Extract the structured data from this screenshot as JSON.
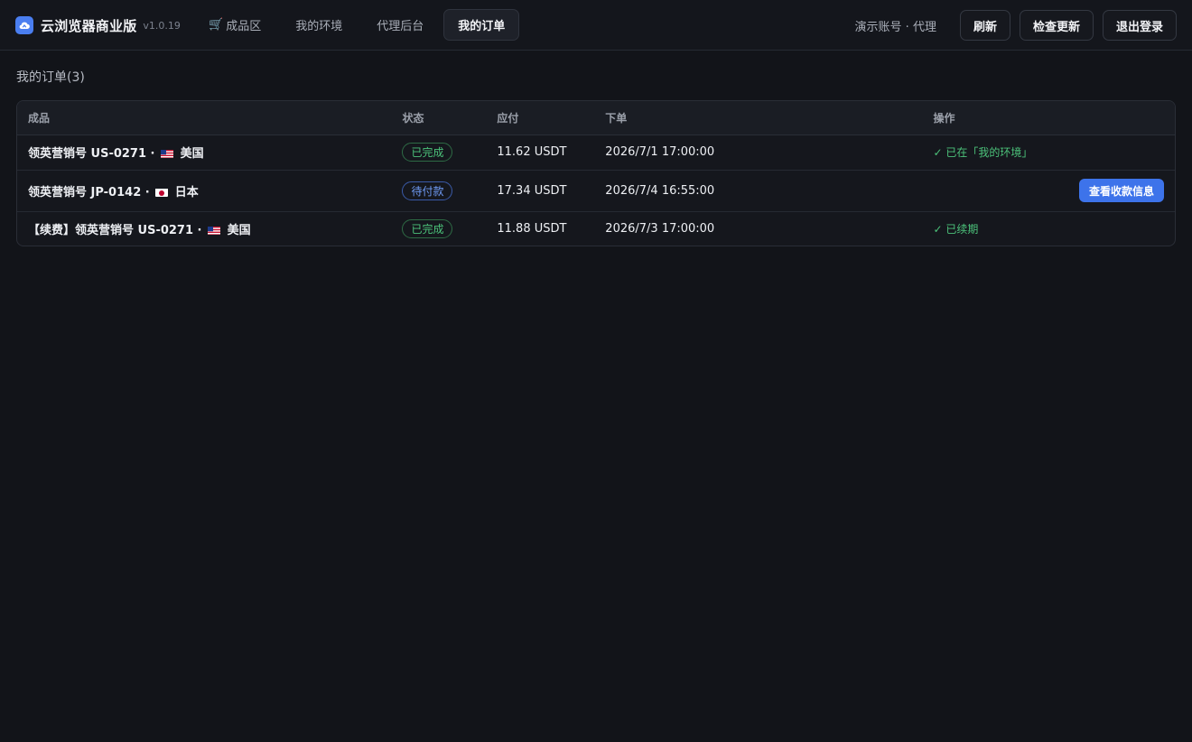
{
  "app": {
    "title": "云浏览器商业版",
    "version": "v1.0.19"
  },
  "nav": {
    "tabs": [
      {
        "label": "成品区",
        "icon": "cart-icon"
      },
      {
        "label": "我的环境"
      },
      {
        "label": "代理后台"
      },
      {
        "label": "我的订单",
        "active": true
      }
    ]
  },
  "header": {
    "account": "演示账号 · 代理",
    "refresh_label": "刷新",
    "check_update_label": "检查更新",
    "logout_label": "退出登录"
  },
  "orders": {
    "title": "我的订单(3)",
    "columns": [
      "成品",
      "状态",
      "应付",
      "下单",
      "操作"
    ],
    "rows": [
      {
        "product_prefix": "领英营销号 US-0271 ·",
        "flag": "us-flag-icon",
        "product_region": "美国",
        "status": "已完成",
        "status_kind": "done",
        "amount": "11.62 USDT",
        "time": "2026/7/1 17:00:00",
        "action": "✓ 已在「我的环境」"
      },
      {
        "product_prefix": "领英营销号 JP-0142 ·",
        "flag": "jp-flag-icon",
        "product_region": "日本",
        "status": "待付款",
        "status_kind": "pending",
        "amount": "17.34 USDT",
        "time": "2026/7/4 16:55:00",
        "action_button": "查看收款信息"
      },
      {
        "product_prefix": "【续费】领英营销号 US-0271 ·",
        "flag": "us-flag-icon",
        "product_region": "美国",
        "status": "已完成",
        "status_kind": "done",
        "amount": "11.88 USDT",
        "time": "2026/7/3 17:00:00",
        "action": "✓ 已续期"
      }
    ]
  },
  "colors": {
    "background": "#121419",
    "accent": "#3d73ea",
    "success": "#4cc27a",
    "pending": "#6f9bf5"
  }
}
